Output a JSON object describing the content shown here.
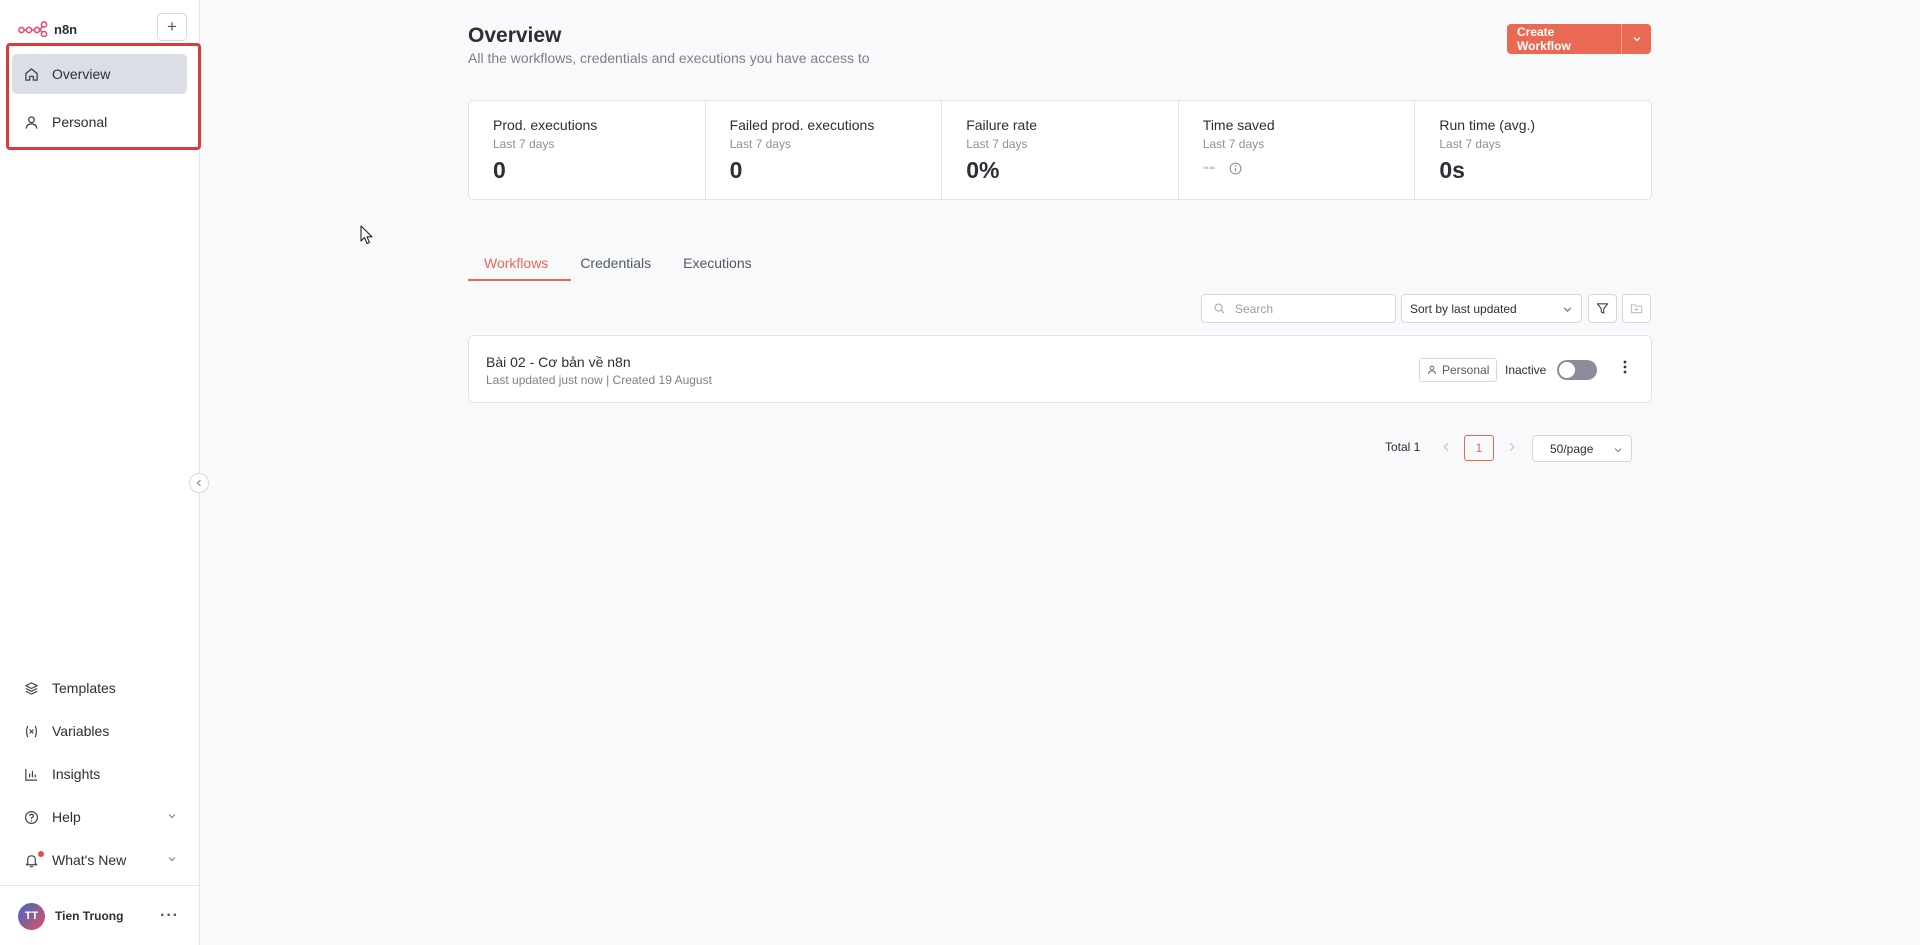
{
  "app": {
    "brand": "n8n",
    "accent": "#ea6953"
  },
  "sidebar": {
    "add_icon": "plus-icon",
    "items": [
      {
        "label": "Overview",
        "icon": "home-icon",
        "active": true
      },
      {
        "label": "Personal",
        "icon": "user-icon",
        "active": false
      }
    ],
    "bottom_items": [
      {
        "label": "Templates",
        "icon": "layers-icon"
      },
      {
        "label": "Variables",
        "icon": "variable-icon"
      },
      {
        "label": "Insights",
        "icon": "bar-chart-icon"
      },
      {
        "label": "Help",
        "icon": "help-circle-icon"
      },
      {
        "label": "What's New",
        "icon": "bell-icon"
      }
    ],
    "user": {
      "initials": "TT",
      "name": "Tien Truong",
      "more": "···"
    }
  },
  "header": {
    "title": "Overview",
    "subtitle": "All the workflows, credentials and executions you have access to",
    "create_label": "Create Workflow"
  },
  "stats": [
    {
      "label": "Prod. executions",
      "period": "Last 7 days",
      "value": "0"
    },
    {
      "label": "Failed prod. executions",
      "period": "Last 7 days",
      "value": "0"
    },
    {
      "label": "Failure rate",
      "period": "Last 7 days",
      "value": "0%"
    },
    {
      "label": "Time saved",
      "period": "Last 7 days",
      "value": "--"
    },
    {
      "label": "Run time (avg.)",
      "period": "Last 7 days",
      "value": "0s"
    }
  ],
  "tabs": [
    {
      "label": "Workflows",
      "active": true
    },
    {
      "label": "Credentials",
      "active": false
    },
    {
      "label": "Executions",
      "active": false
    }
  ],
  "toolbar": {
    "search_placeholder": "Search",
    "sort_value": "Sort by last updated"
  },
  "workflows": [
    {
      "name": "Bài 02 - Cơ bản về n8n",
      "meta": "Last updated just now | Created 19 August",
      "owner": "Personal",
      "status": "Inactive",
      "active": false
    }
  ],
  "pagination": {
    "total": "Total 1",
    "current_page": "1",
    "page_size": "50/page"
  }
}
